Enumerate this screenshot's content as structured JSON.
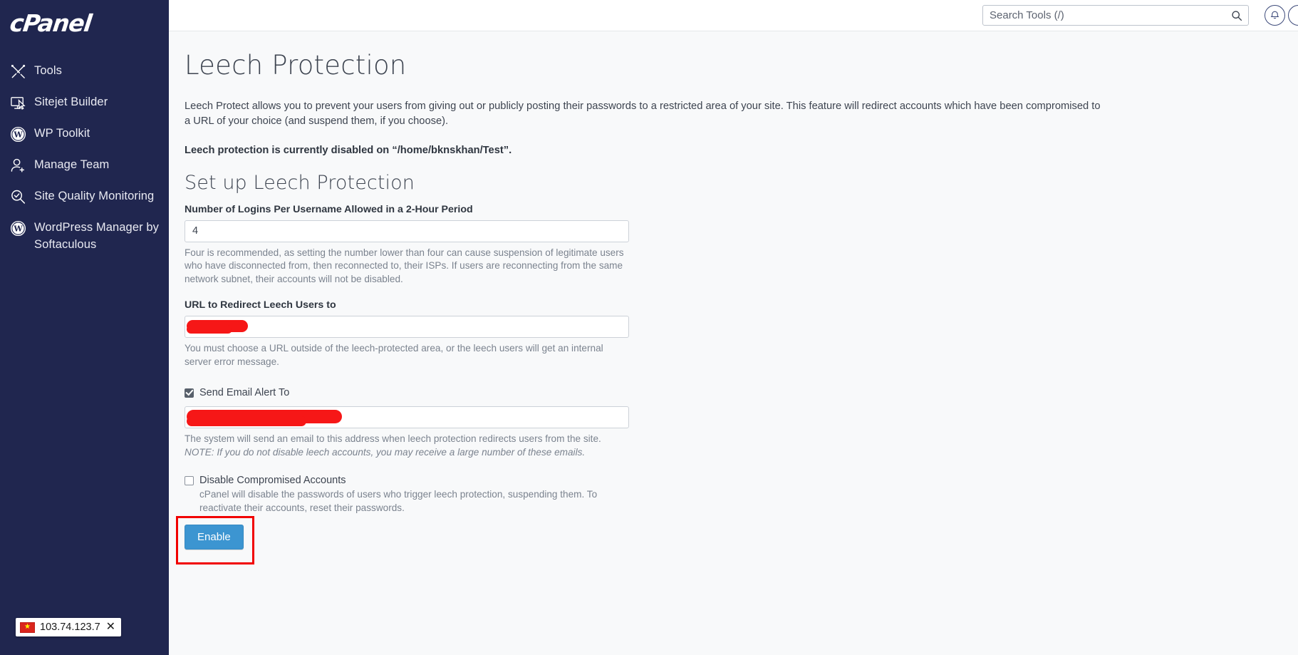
{
  "sidebar": {
    "logo": "cPanel",
    "items": [
      {
        "label": "Tools",
        "icon": "tools-icon"
      },
      {
        "label": "Sitejet Builder",
        "icon": "monitor-cursor-icon"
      },
      {
        "label": "WP Toolkit",
        "icon": "wordpress-icon"
      },
      {
        "label": "Manage Team",
        "icon": "user-plus-icon"
      },
      {
        "label": "Site Quality Monitoring",
        "icon": "magnifier-check-icon"
      },
      {
        "label": "WordPress Manager by Softaculous",
        "icon": "wordpress-icon"
      }
    ],
    "ip_bar": {
      "ip": "103.74.123.7",
      "flag": "vietnam-flag-icon",
      "close": "✕"
    }
  },
  "topbar": {
    "search_placeholder": "Search Tools (/)",
    "search_value": "",
    "search_icon": "search-icon",
    "notifications_icon": "bell-icon",
    "avatar_icon": "user-avatar-icon"
  },
  "main": {
    "page_title": "Leech Protection",
    "intro": "Leech Protect allows you to prevent your users from giving out or publicly posting their passwords to a restricted area of your site. This feature will redirect accounts which have been compromised to a URL of your choice (and suspend them, if you choose).",
    "status_line": "Leech protection is currently disabled on “/home/bknskhan/Test”.",
    "section_title": "Set up Leech Protection",
    "logins": {
      "label": "Number of Logins Per Username Allowed in a 2-Hour Period",
      "value": "4",
      "help": "Four is recommended, as setting the number lower than four can cause suspension of legitimate users who have disconnected from, then reconnected to, their ISPs. If users are reconnecting from the same network subnet, their accounts will not be disabled."
    },
    "redirect_url": {
      "label": "URL to Redirect Leech Users to",
      "value": "",
      "help": "You must choose a URL outside of the leech-protected area, or the leech users will get an internal server error message."
    },
    "email_alert": {
      "label": "Send Email Alert To",
      "checked": true,
      "value": "",
      "help": "The system will send an email to this address when leech protection redirects users from the site.",
      "help_note": "NOTE: If you do not disable leech accounts, you may receive a large number of these emails."
    },
    "disable_accounts": {
      "label": "Disable Compromised Accounts",
      "checked": false,
      "help": "cPanel will disable the passwords of users who trigger leech protection, suspending them. To reactivate their accounts, reset their passwords."
    },
    "enable_button": "Enable"
  },
  "colors": {
    "sidebar_bg": "#20264f",
    "accent_blue": "#3c95d1",
    "annotation_red": "#f10000",
    "redaction_red": "#f61717",
    "content_bg": "#f8f9fa"
  }
}
